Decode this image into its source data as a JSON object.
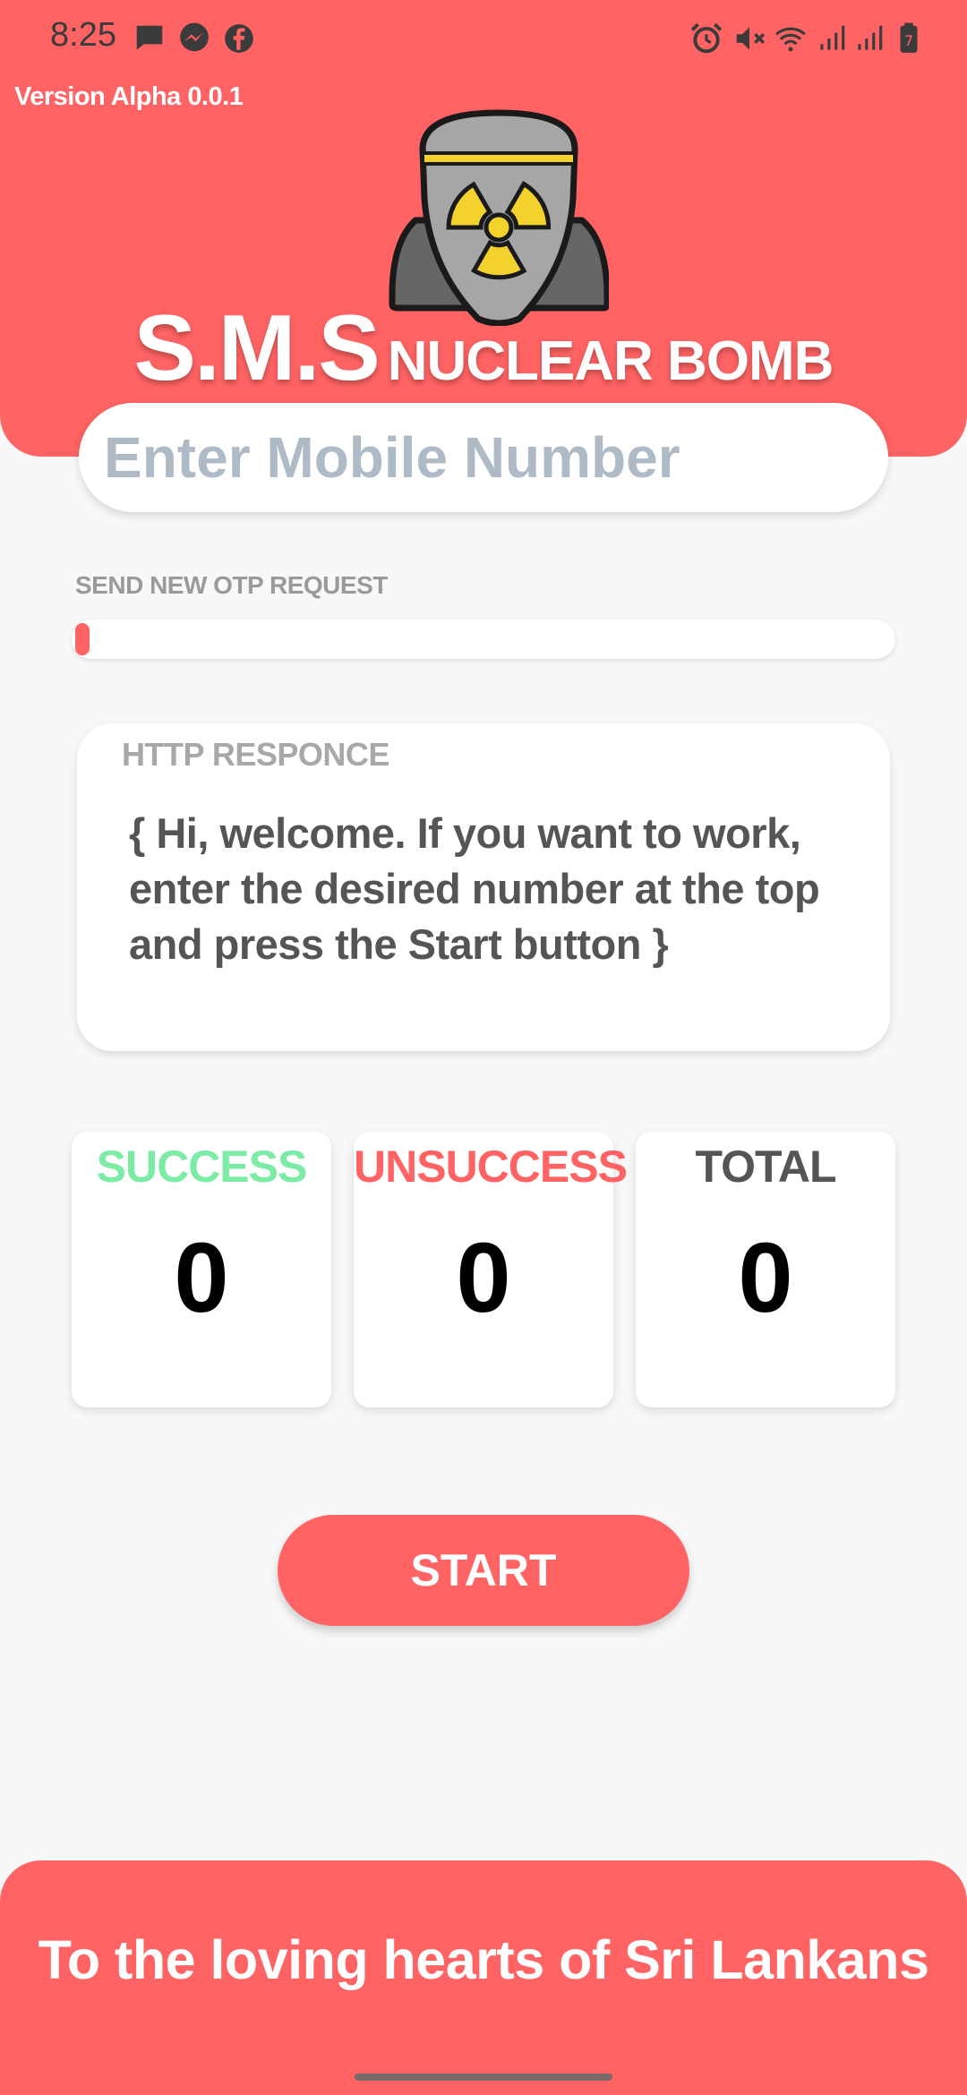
{
  "status_bar": {
    "time": "8:25",
    "left_icons": [
      "message-icon",
      "messenger-icon",
      "facebook-icon"
    ],
    "right_icons": [
      "alarm-icon",
      "mute-icon",
      "wifi-icon",
      "signal-icon",
      "signal-icon",
      "battery-icon"
    ],
    "battery_level_text": "7"
  },
  "header": {
    "version": "Version Alpha 0.0.1",
    "title_main": "S.M.S",
    "title_sub": "NUCLEAR BOMB",
    "logo": "nuclear-bomb-icon"
  },
  "phone_input": {
    "placeholder": "Enter Mobile Number",
    "value": ""
  },
  "otp": {
    "label": "SEND NEW OTP REQUEST",
    "progress": 0
  },
  "http_response": {
    "label": "HTTP RESPONCE",
    "text": "{ Hi, welcome. If you want to work, enter the desired number at the top and press the Start button }"
  },
  "stats": {
    "success": {
      "label": "SUCCESS",
      "value": "0",
      "color": "#7beba6"
    },
    "unsuccess": {
      "label": "UNSUCCESS",
      "value": "0",
      "color": "#ff6363"
    },
    "total": {
      "label": "TOTAL",
      "value": "0",
      "color": "#555555"
    }
  },
  "start_button": {
    "label": "START"
  },
  "footer": {
    "text": "To the loving hearts of Sri Lankans"
  },
  "colors": {
    "accent": "#ff6363",
    "background": "#f8f8f8",
    "card": "#ffffff",
    "success": "#7beba6"
  }
}
